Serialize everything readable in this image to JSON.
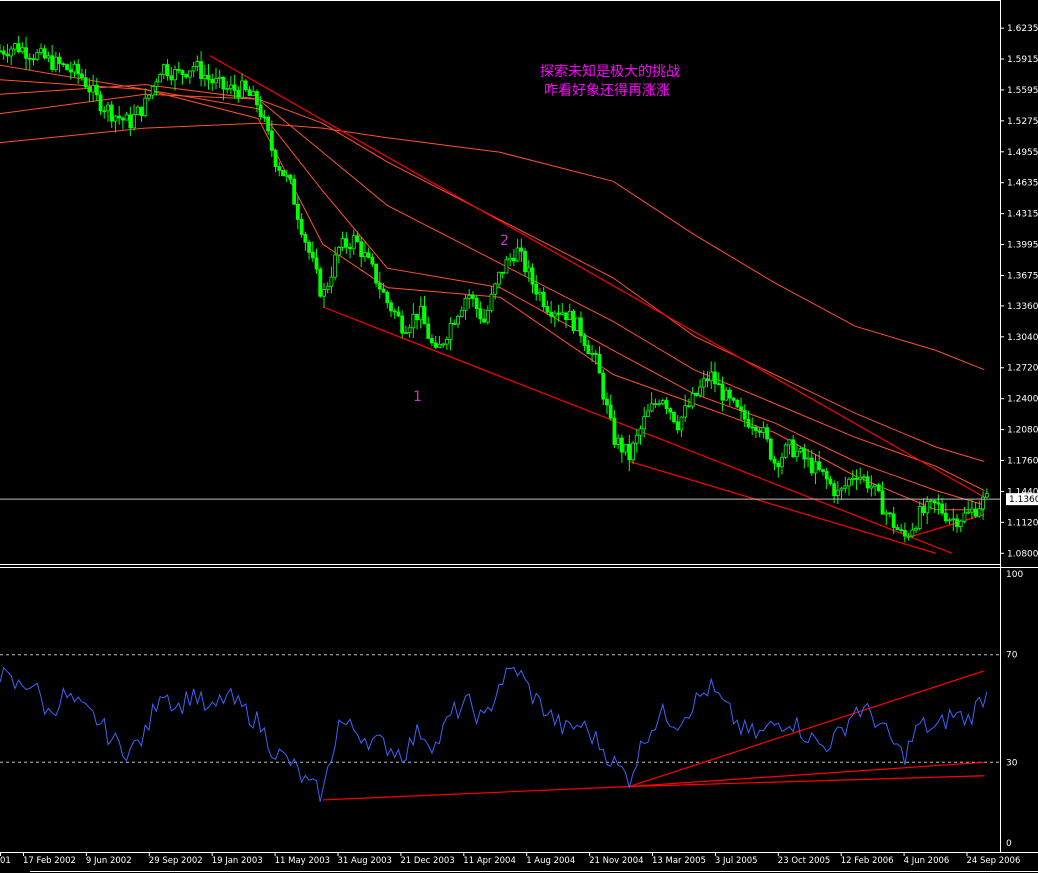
{
  "annotation": {
    "line1": "探索未知是极大的挑战",
    "line2": "咋看好象还得再涨涨"
  },
  "colors": {
    "background": "#000000",
    "bull_candle": "#00ff00",
    "bear_candle": "#00ff00",
    "ma_lines": "#ff5030",
    "trendlines": "#ff0000",
    "rsi_line": "#3c64ff",
    "axis": "#ffffff",
    "annotation": "#ff00ff",
    "wave_labels": "#cc33cc"
  },
  "chart_data": [
    {
      "type": "candlestick",
      "panel": "price",
      "price_scale": {
        "labels": [
          "1.6235",
          "1.5915",
          "1.5595",
          "1.5275",
          "1.4955",
          "1.4635",
          "1.4315",
          "1.3995",
          "1.3675",
          "1.3360",
          "1.3040",
          "1.2720",
          "1.2400",
          "1.2080",
          "1.1760",
          "1.1440",
          "1.1120",
          "1.0800"
        ],
        "ylim": [
          1.072,
          1.635
        ]
      },
      "current_price": "1.1360",
      "wave_labels": [
        "1",
        "2"
      ],
      "price_path": [
        [
          "Sep 2001",
          1.6
        ],
        [
          "Oct 2001",
          1.605
        ],
        [
          "Dec 2001",
          1.59
        ],
        [
          "Feb 2002",
          1.575
        ],
        [
          "Mar 2002",
          1.55
        ],
        [
          "Apr 2002",
          1.535
        ],
        [
          "May 2002",
          1.525
        ],
        [
          "Jun 2002",
          1.545
        ],
        [
          "Jul 2002",
          1.585
        ],
        [
          "Aug 2002",
          1.575
        ],
        [
          "Sep 2002",
          1.585
        ],
        [
          "Oct 2002",
          1.57
        ],
        [
          "Nov 2002",
          1.56
        ],
        [
          "Dec 2002",
          1.56
        ],
        [
          "Jan 2003",
          1.545
        ],
        [
          "Feb 2003",
          1.49
        ],
        [
          "Mar 2003",
          1.46
        ],
        [
          "Apr 2003",
          1.4
        ],
        [
          "May 2003",
          1.345
        ],
        [
          "Jun 2003",
          1.395
        ],
        [
          "Jul 2003",
          1.405
        ],
        [
          "Aug 2003",
          1.375
        ],
        [
          "Sep 2003",
          1.34
        ],
        [
          "Oct 2003",
          1.315
        ],
        [
          "Nov 2003",
          1.33
        ],
        [
          "Dec 2003",
          1.285
        ],
        [
          "Jan 2004",
          1.32
        ],
        [
          "Feb 2004",
          1.35
        ],
        [
          "Mar 2004",
          1.32
        ],
        [
          "Apr 2004",
          1.37
        ],
        [
          "May 2004",
          1.395
        ],
        [
          "Jun 2004",
          1.36
        ],
        [
          "Jul 2004",
          1.335
        ],
        [
          "Aug 2004",
          1.33
        ],
        [
          "Sep 2004",
          1.31
        ],
        [
          "Oct 2004",
          1.275
        ],
        [
          "Nov 2004",
          1.2
        ],
        [
          "Dec 2004",
          1.18
        ],
        [
          "Jan 2005",
          1.22
        ],
        [
          "Feb 2005",
          1.245
        ],
        [
          "Mar 2005",
          1.215
        ],
        [
          "Apr 2005",
          1.24
        ],
        [
          "May 2005",
          1.265
        ],
        [
          "Jun 2005",
          1.24
        ],
        [
          "Jul 2005",
          1.22
        ],
        [
          "Aug 2005",
          1.215
        ],
        [
          "Sep 2005",
          1.175
        ],
        [
          "Oct 2005",
          1.19
        ],
        [
          "Nov 2005",
          1.175
        ],
        [
          "Dec 2005",
          1.16
        ],
        [
          "Jan 2006",
          1.14
        ],
        [
          "Feb 2006",
          1.165
        ],
        [
          "Mar 2006",
          1.15
        ],
        [
          "Apr 2006",
          1.12
        ],
        [
          "May 2006",
          1.095
        ],
        [
          "Jun 2006",
          1.12
        ],
        [
          "Jul 2006",
          1.13
        ],
        [
          "Aug 2006",
          1.115
        ],
        [
          "Sep 2006",
          1.12
        ],
        [
          "Oct 2006",
          1.135
        ]
      ],
      "moving_averages": [
        {
          "points": [
            [
              "Sep 2001",
              1.585
            ],
            [
              "Jun 2002",
              1.56
            ],
            [
              "Jan 2003",
              1.53
            ],
            [
              "May 2003",
              1.4
            ],
            [
              "Sep 2003",
              1.355
            ],
            [
              "Apr 2004",
              1.345
            ],
            [
              "Nov 2004",
              1.265
            ],
            [
              "Apr 2005",
              1.235
            ],
            [
              "Sep 2005",
              1.205
            ],
            [
              "Feb 2006",
              1.16
            ],
            [
              "Jul 2006",
              1.125
            ],
            [
              "Oct 2006",
              1.125
            ]
          ]
        },
        {
          "points": [
            [
              "Sep 2001",
              1.57
            ],
            [
              "Jun 2002",
              1.56
            ],
            [
              "Jan 2003",
              1.54
            ],
            [
              "May 2003",
              1.455
            ],
            [
              "Sep 2003",
              1.375
            ],
            [
              "Apr 2004",
              1.355
            ],
            [
              "Nov 2004",
              1.29
            ],
            [
              "Apr 2005",
              1.245
            ],
            [
              "Sep 2005",
              1.215
            ],
            [
              "Feb 2006",
              1.175
            ],
            [
              "Jul 2006",
              1.145
            ],
            [
              "Oct 2006",
              1.13
            ]
          ]
        },
        {
          "points": [
            [
              "Sep 2001",
              1.555
            ],
            [
              "Jun 2002",
              1.565
            ],
            [
              "Jan 2003",
              1.55
            ],
            [
              "May 2003",
              1.495
            ],
            [
              "Sep 2003",
              1.44
            ],
            [
              "Apr 2004",
              1.38
            ],
            [
              "Nov 2004",
              1.32
            ],
            [
              "Apr 2005",
              1.27
            ],
            [
              "Sep 2005",
              1.235
            ],
            [
              "Feb 2006",
              1.2
            ],
            [
              "Jul 2006",
              1.17
            ],
            [
              "Oct 2006",
              1.145
            ]
          ]
        },
        {
          "points": [
            [
              "Sep 2001",
              1.535
            ],
            [
              "Jun 2002",
              1.555
            ],
            [
              "Jan 2003",
              1.55
            ],
            [
              "May 2003",
              1.525
            ],
            [
              "Sep 2003",
              1.485
            ],
            [
              "Apr 2004",
              1.425
            ],
            [
              "Nov 2004",
              1.365
            ],
            [
              "Apr 2005",
              1.305
            ],
            [
              "Sep 2005",
              1.265
            ],
            [
              "Feb 2006",
              1.225
            ],
            [
              "Jul 2006",
              1.19
            ],
            [
              "Oct 2006",
              1.175
            ]
          ]
        },
        {
          "points": [
            [
              "Sep 2001",
              1.505
            ],
            [
              "Jun 2002",
              1.52
            ],
            [
              "Jan 2003",
              1.525
            ],
            [
              "May 2003",
              1.52
            ],
            [
              "Sep 2003",
              1.51
            ],
            [
              "Apr 2004",
              1.495
            ],
            [
              "Nov 2004",
              1.465
            ],
            [
              "Apr 2005",
              1.41
            ],
            [
              "Sep 2005",
              1.36
            ],
            [
              "Feb 2006",
              1.315
            ],
            [
              "Jul 2006",
              1.29
            ],
            [
              "Oct 2006",
              1.27
            ]
          ]
        }
      ],
      "trendlines": [
        {
          "points": [
            [
              "Oct 2002",
              1.595
            ],
            [
              "Oct 2006",
              1.138
            ]
          ]
        },
        {
          "points": [
            [
              "May 2003",
              1.335
            ],
            [
              "Aug 2006",
              1.08
            ]
          ]
        },
        {
          "points": [
            [
              "Dec 2004",
              1.175
            ],
            [
              "Jul 2006",
              1.08
            ]
          ]
        },
        {
          "points": [
            [
              "May 2006",
              1.095
            ],
            [
              "Oct 2006",
              1.12
            ]
          ]
        }
      ]
    },
    {
      "type": "line",
      "panel": "indicator",
      "scale_labels": [
        "100",
        "70",
        "30",
        "0"
      ],
      "ylim": [
        0,
        100
      ],
      "levels": [
        70,
        30
      ],
      "series": [
        {
          "values": [
            [
              "Sep 2001",
              63
            ],
            [
              "Oct 2001",
              58
            ],
            [
              "Nov 2001",
              60
            ],
            [
              "Dec 2001",
              48
            ],
            [
              "Jan 2002",
              55
            ],
            [
              "Feb 2002",
              50
            ],
            [
              "Mar 2002",
              46
            ],
            [
              "Apr 2002",
              38
            ],
            [
              "May 2002",
              34
            ],
            [
              "Jun 2002",
              40
            ],
            [
              "Jul 2002",
              58
            ],
            [
              "Aug 2002",
              50
            ],
            [
              "Sep 2002",
              56
            ],
            [
              "Oct 2002",
              48
            ],
            [
              "Nov 2002",
              55
            ],
            [
              "Dec 2002",
              50
            ],
            [
              "Jan 2003",
              45
            ],
            [
              "Feb 2003",
              34
            ],
            [
              "Mar 2003",
              30
            ],
            [
              "Apr 2003",
              22
            ],
            [
              "May 2003",
              18
            ],
            [
              "Jun 2003",
              45
            ],
            [
              "Jul 2003",
              42
            ],
            [
              "Aug 2003",
              38
            ],
            [
              "Sep 2003",
              36
            ],
            [
              "Oct 2003",
              33
            ],
            [
              "Nov 2003",
              42
            ],
            [
              "Dec 2003",
              36
            ],
            [
              "Jan 2004",
              48
            ],
            [
              "Feb 2004",
              52
            ],
            [
              "Mar 2004",
              45
            ],
            [
              "Apr 2004",
              60
            ],
            [
              "May 2004",
              65
            ],
            [
              "Jun 2004",
              55
            ],
            [
              "Jul 2004",
              48
            ],
            [
              "Aug 2004",
              42
            ],
            [
              "Sep 2004",
              44
            ],
            [
              "Oct 2004",
              38
            ],
            [
              "Nov 2004",
              30
            ],
            [
              "Dec 2004",
              24
            ],
            [
              "Jan 2005",
              40
            ],
            [
              "Feb 2005",
              48
            ],
            [
              "Mar 2005",
              45
            ],
            [
              "Apr 2005",
              52
            ],
            [
              "May 2005",
              58
            ],
            [
              "Jun 2005",
              50
            ],
            [
              "Jul 2005",
              42
            ],
            [
              "Aug 2005",
              40
            ],
            [
              "Sep 2005",
              44
            ],
            [
              "Oct 2005",
              46
            ],
            [
              "Nov 2005",
              40
            ],
            [
              "Dec 2005",
              36
            ],
            [
              "Jan 2006",
              40
            ],
            [
              "Feb 2006",
              50
            ],
            [
              "Mar 2006",
              48
            ],
            [
              "Apr 2006",
              40
            ],
            [
              "May 2006",
              32
            ],
            [
              "Jun 2006",
              44
            ],
            [
              "Jul 2006",
              42
            ],
            [
              "Aug 2006",
              48
            ],
            [
              "Sep 2006",
              46
            ],
            [
              "Oct 2006",
              55
            ]
          ]
        }
      ],
      "trendlines": [
        {
          "points": [
            [
              "May 2003",
              16
            ],
            [
              "Dec 2004",
              21
            ]
          ]
        },
        {
          "points": [
            [
              "Dec 2004",
              21
            ],
            [
              "Oct 2006",
              64
            ]
          ]
        },
        {
          "points": [
            [
              "Dec 2004",
              21
            ],
            [
              "Oct 2006",
              30
            ]
          ]
        },
        {
          "points": [
            [
              "Dec 2004",
              21
            ],
            [
              "Oct 2006",
              25
            ]
          ]
        }
      ]
    }
  ],
  "x_axis": {
    "tick_labels": [
      "01",
      "17 Feb 2002",
      "9 Jun 2002",
      "29 Sep 2002",
      "19 Jan 2003",
      "11 May 2003",
      "31 Aug 2003",
      "21 Dec 2003",
      "11 Apr 2004",
      "1 Aug 2004",
      "21 Nov 2004",
      "13 Mar 2005",
      "3 Jul 2005",
      "23 Oct 2005",
      "12 Feb 2006",
      "4 Jun 2006",
      "24 Sep 2006"
    ]
  }
}
